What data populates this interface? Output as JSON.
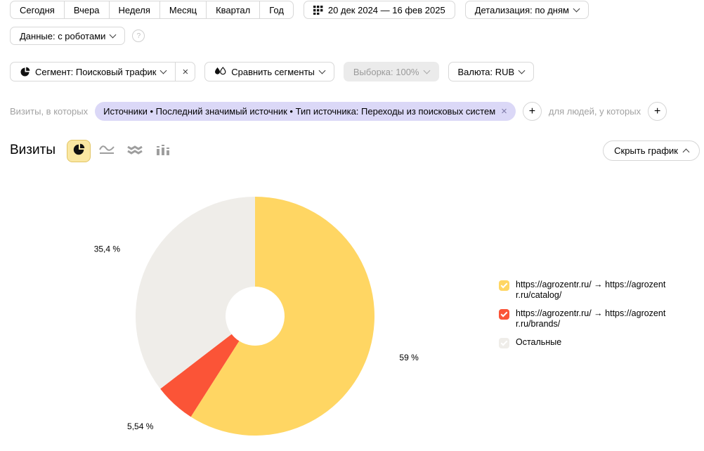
{
  "toolbar": {
    "periods": [
      "Сегодня",
      "Вчера",
      "Неделя",
      "Месяц",
      "Квартал",
      "Год"
    ],
    "date_range": "20 дек 2024 — 16 фев 2025",
    "detalization": "Детализация: по дням"
  },
  "data_controls": {
    "data_mode": "Данные: с роботами",
    "help_glyph": "?"
  },
  "segment_controls": {
    "segment": "Сегмент: Поисковый трафик",
    "compare": "Сравнить сегменты",
    "sampling": "Выборка: 100%",
    "currency": "Валюта: RUB"
  },
  "filters": {
    "visits_prefix": "Визиты, в которых",
    "chip": "Источники • Последний значимый источник • Тип источника: Переходы из поисковых систем",
    "people_prefix": "для людей, у которых"
  },
  "glyphs": {
    "close": "×",
    "plus": "+"
  },
  "metric": {
    "title": "Визиты",
    "hide_chart": "Скрыть график"
  },
  "icons": {
    "calendar": "calendar-grid-icon",
    "segment": "pie-icon",
    "compare": "water-drops-icon",
    "chart_types": [
      "pie-chart-icon",
      "line-chart-icon",
      "stacked-area-icon",
      "column-chart-icon"
    ],
    "selected_chart_type": "pie-chart-icon"
  },
  "chart_data": {
    "type": "pie",
    "donut": true,
    "title": "Визиты",
    "start_angle": "12 o'clock, clockwise",
    "legend_position": "right",
    "slices": [
      {
        "label": "https://agrozentr.ru/ → https://agrozentr.ru/catalog/",
        "value_pct": 59,
        "display": "59 %",
        "color": "#FFD663"
      },
      {
        "label": "https://agrozentr.ru/ → https://agrozentr.ru/brands/",
        "value_pct": 5.54,
        "display": "5,54 %",
        "color": "#FB5437"
      },
      {
        "label": "Остальные",
        "value_pct": 35.4,
        "display": "35,4 %",
        "color": "#EFEDE9"
      }
    ]
  }
}
